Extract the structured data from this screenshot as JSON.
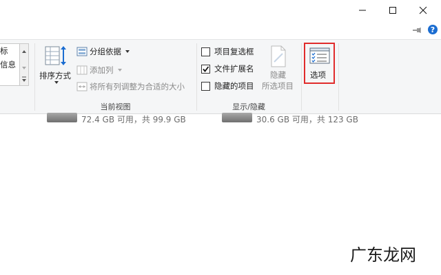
{
  "window": {
    "minimize_icon": "minimize-icon",
    "maximize_icon": "maximize-icon",
    "close_icon": "close-icon",
    "help_label": "?"
  },
  "ribbon": {
    "left_partial": {
      "item1": "标",
      "item2": "信息"
    },
    "current_view": {
      "sort_label": "排序方式",
      "group_by": "分组依据",
      "add_columns": "添加列",
      "fit_columns": "将所有列调整为合适的大小",
      "group_label": "当前视图"
    },
    "show_hide": {
      "item_checkboxes": {
        "label": "项目复选框",
        "checked": false
      },
      "file_extensions": {
        "label": "文件扩展名",
        "checked": true
      },
      "hidden_items": {
        "label": "隐藏的项目",
        "checked": false
      },
      "hide_selected_line1": "隐藏",
      "hide_selected_line2": "所选项目",
      "group_label": "显示/隐藏"
    },
    "options": {
      "label": "选项"
    }
  },
  "drives": [
    {
      "info": "72.4 GB 可用，共 99.9 GB"
    },
    {
      "info": "30.6 GB 可用，共 123 GB"
    }
  ],
  "watermark": "广东龙网",
  "colors": {
    "accent": "#1b6dd1",
    "highlight": "#e02a2a"
  }
}
